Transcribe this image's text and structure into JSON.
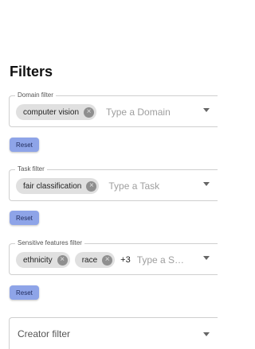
{
  "title": "Filters",
  "domain": {
    "legend": "Domain filter",
    "chips": [
      "computer vision"
    ],
    "placeholder": "Type a Domain",
    "reset": "Reset"
  },
  "task": {
    "legend": "Task filter",
    "chips": [
      "fair classification"
    ],
    "placeholder": "Type a Task",
    "reset": "Reset"
  },
  "sensitive": {
    "legend": "Sensitive features filter",
    "chips": [
      "ethnicity",
      "race"
    ],
    "more": "+3",
    "placeholder": "Type a S…",
    "reset": "Reset"
  },
  "creator": {
    "label": "Creator filter"
  },
  "colors": {
    "reset_button": "#8ea4e8",
    "chip": "#e0e0e0"
  }
}
